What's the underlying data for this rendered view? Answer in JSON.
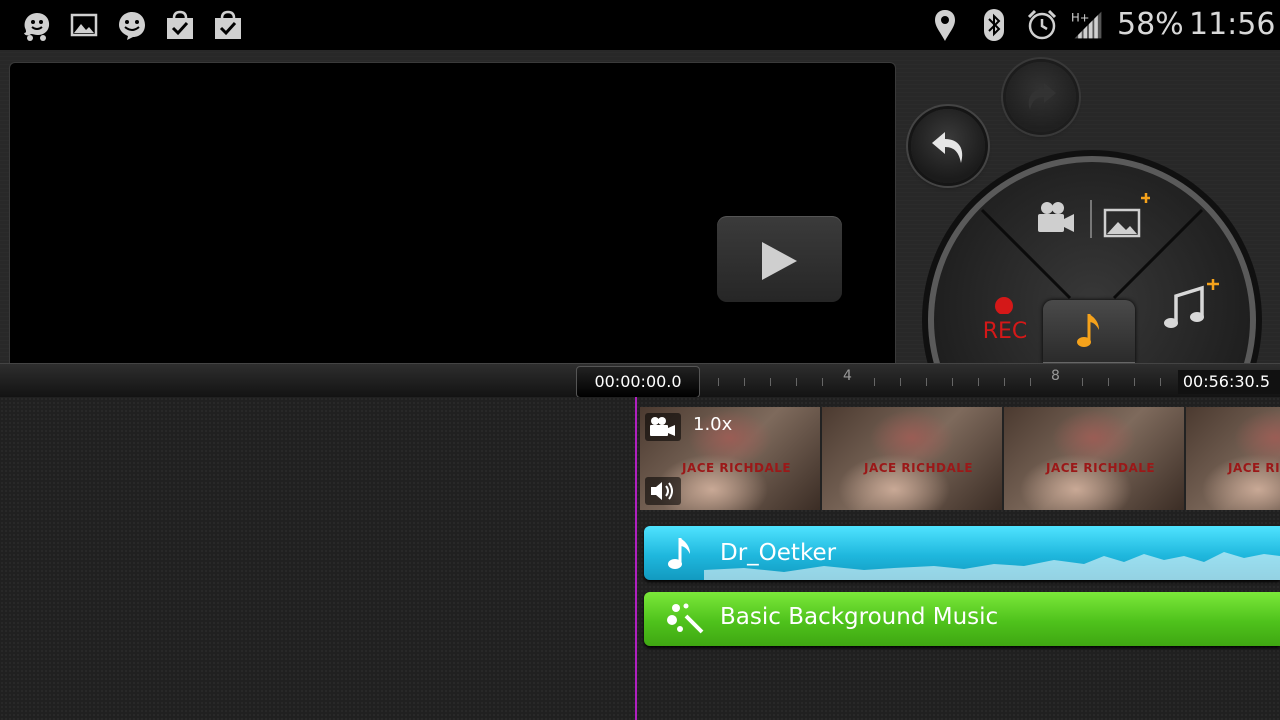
{
  "status_bar": {
    "battery": "58%",
    "time": "11:56",
    "network": "H+",
    "left_icons": [
      "waze-icon",
      "image-icon",
      "smiley-icon",
      "shopping-bag-icon",
      "shopping-bag-icon"
    ],
    "right_icons": [
      "location-icon",
      "bluetooth-icon",
      "alarm-icon",
      "signal-icon"
    ]
  },
  "preview": {
    "play_icon": "play-icon"
  },
  "controls": {
    "undo_icon": "undo-icon",
    "redo_icon": "redo-icon",
    "rec_label": "REC",
    "add_media_icon": "add-media-icon",
    "add_music_icon": "add-music-icon",
    "center_icon": "music-note-icon"
  },
  "timeline": {
    "current_time": "00:00:00.0",
    "total_time": "00:56:30.5",
    "tick_labels": [
      "4",
      "8"
    ]
  },
  "tracks": {
    "video": {
      "speed": "1.0x",
      "thumb_text": "JACE RICHDALE",
      "thumb_count": 4
    },
    "audio": {
      "name": "Dr_Oetker"
    },
    "background": {
      "name": "Basic Background Music"
    }
  },
  "colors": {
    "accent_orange": "#f5a21b",
    "rec_red": "#d41818",
    "audio_track": "#2ec8ee",
    "bg_music_track": "#5cce22",
    "playhead": "#b020c0"
  }
}
